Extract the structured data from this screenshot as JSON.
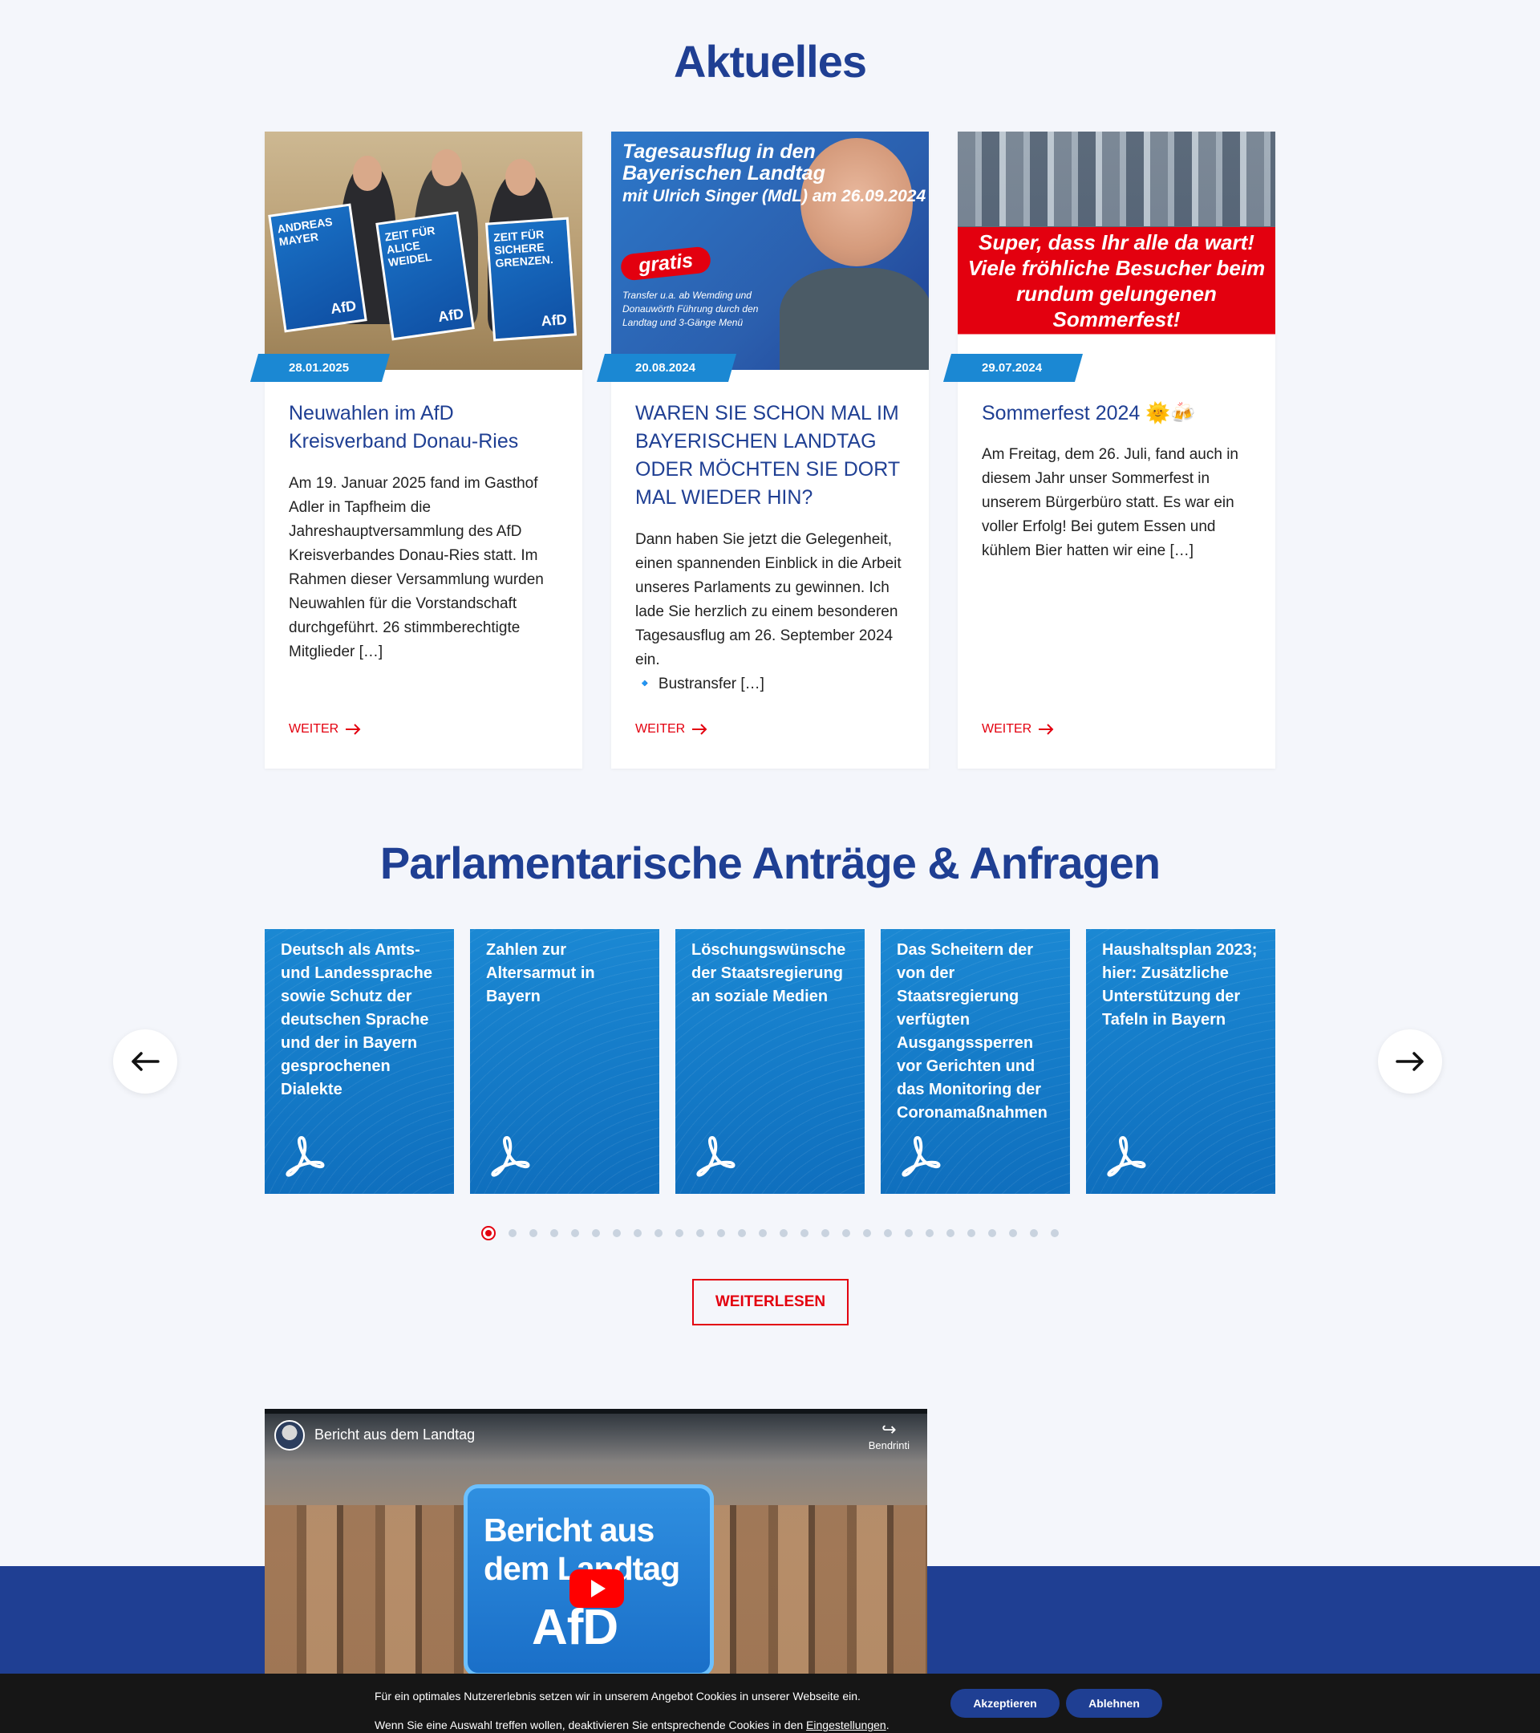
{
  "news": {
    "heading": "Aktuelles",
    "more_label": "WEITER",
    "cards": [
      {
        "date": "28.01.2025",
        "title": "Neuwahlen im AfD Kreisverband Donau-Ries",
        "excerpt": "Am 19. Januar 2025 fand im Gasthof Adler in Tapfheim die Jahreshauptversammlung des AfD Kreisverbandes Donau-Ries statt. Im Rahmen dieser Versammlung wurden Neuwahlen für die Vorstandschaft durchgeführt. 26 stimmberechtigte Mitglieder […]",
        "image": {
          "poster1": "ANDREAS MAYER",
          "poster2": "ZEIT FÜR ALICE WEIDEL",
          "poster3": "ZEIT FÜR SICHERE GRENZEN.",
          "brand": "AfD"
        }
      },
      {
        "date": "20.08.2024",
        "title": "WAREN SIE SCHON MAL IM BAYERISCHEN LANDTAG ODER MÖCHTEN SIE DORT MAL WIEDER HIN?",
        "excerpt": "Dann haben Sie jetzt die Gelegenheit, einen spannenden Einblick in die Arbeit unseres Parlaments zu gewinnen. Ich lade Sie herzlich zu einem besonderen Tagesausflug am 26. September 2024 ein.",
        "excerpt_extra": "🔹 Bustransfer […]",
        "image": {
          "headline": "Tagesausflug in den Bayerischen Landtag",
          "line2": "mit Ulrich Singer (MdL) am 26.09.2024",
          "badge": "gratis",
          "details": "Transfer u.a. ab Wemding und Donauwörth Führung durch den Landtag und 3-Gänge Menü"
        }
      },
      {
        "date": "29.07.2024",
        "title": "Sommerfest 2024 🌞🍻",
        "excerpt": "Am Freitag, dem 26. Juli, fand auch in diesem Jahr unser Sommerfest in unserem Bürgerbüro statt. Es war ein voller Erfolg! Bei gutem Essen und kühlem Bier hatten wir eine […]",
        "image": {
          "headline": "Super, dass Ihr alle da wart! Viele fröhliche Besucher beim rundum gelungenen Sommerfest!"
        }
      }
    ]
  },
  "parliament": {
    "heading": "Parlamentarische Anträge & Anfragen",
    "cards": [
      {
        "title": "Deutsch als Amts- und Landessprache sowie Schutz der deutschen Sprache und der in Bayern gesprochenen Dialekte"
      },
      {
        "title": "Zahlen zur Altersarmut in Bayern"
      },
      {
        "title": "Löschungswünsche der Staatsregierung an soziale Medien"
      },
      {
        "title": "Das Scheitern der von der Staatsregierung verfügten Ausgangssperren vor Gerichten und das Monitoring der Coronamaßnahmen"
      },
      {
        "title": "Haushaltsplan 2023; hier: Zusätzliche Unterstützung der Tafeln in Bayern"
      }
    ],
    "dot_count": 28,
    "active_dot": 0,
    "read_more": "WEITERLESEN"
  },
  "video": {
    "title": "Bericht aus dem Landtag",
    "share_label": "Bendrinti",
    "badge_text": "Bericht aus dem Landtag",
    "badge_brand": "AfD"
  },
  "cookie": {
    "line1": "Für ein optimales Nutzererlebnis setzen wir in unserem Angebot Cookies in unserer Webseite ein.",
    "line2_prefix": "Wenn Sie eine Auswahl treffen wollen, deaktivieren Sie entsprechende Cookies in den ",
    "line2_link": "Eingestellungen",
    "line2_suffix": ".",
    "accept": "Akzeptieren",
    "decline": "Ablehnen"
  },
  "colors": {
    "brand_blue": "#1f3f93",
    "accent_blue": "#1b88d3",
    "red": "#e3000f",
    "background": "#f4f6fb"
  }
}
